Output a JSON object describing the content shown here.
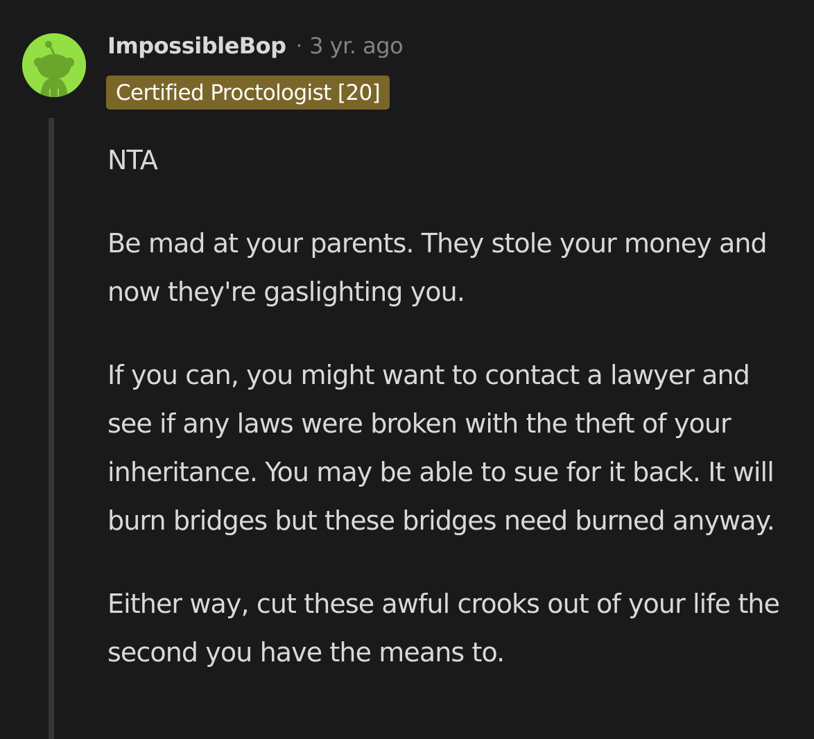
{
  "comment": {
    "author": "ImpossibleBop",
    "separator": "·",
    "timestamp": "3 yr. ago",
    "flair": "Certified Proctologist [20]",
    "avatar_icon": "snoo-avatar-icon",
    "avatar_bg": "#94e044",
    "flair_bg": "#7a6628",
    "paragraphs": [
      "NTA",
      "Be mad at your parents. They stole your money and now they're gaslighting you.",
      "If you can, you might want to contact a lawyer and see if any laws were broken with the theft of your inheritance. You may be able to sue for it back. It will burn bridges but these bridges need burned anyway.",
      "Either way, cut these awful crooks out of your life the second you have the means to."
    ]
  }
}
